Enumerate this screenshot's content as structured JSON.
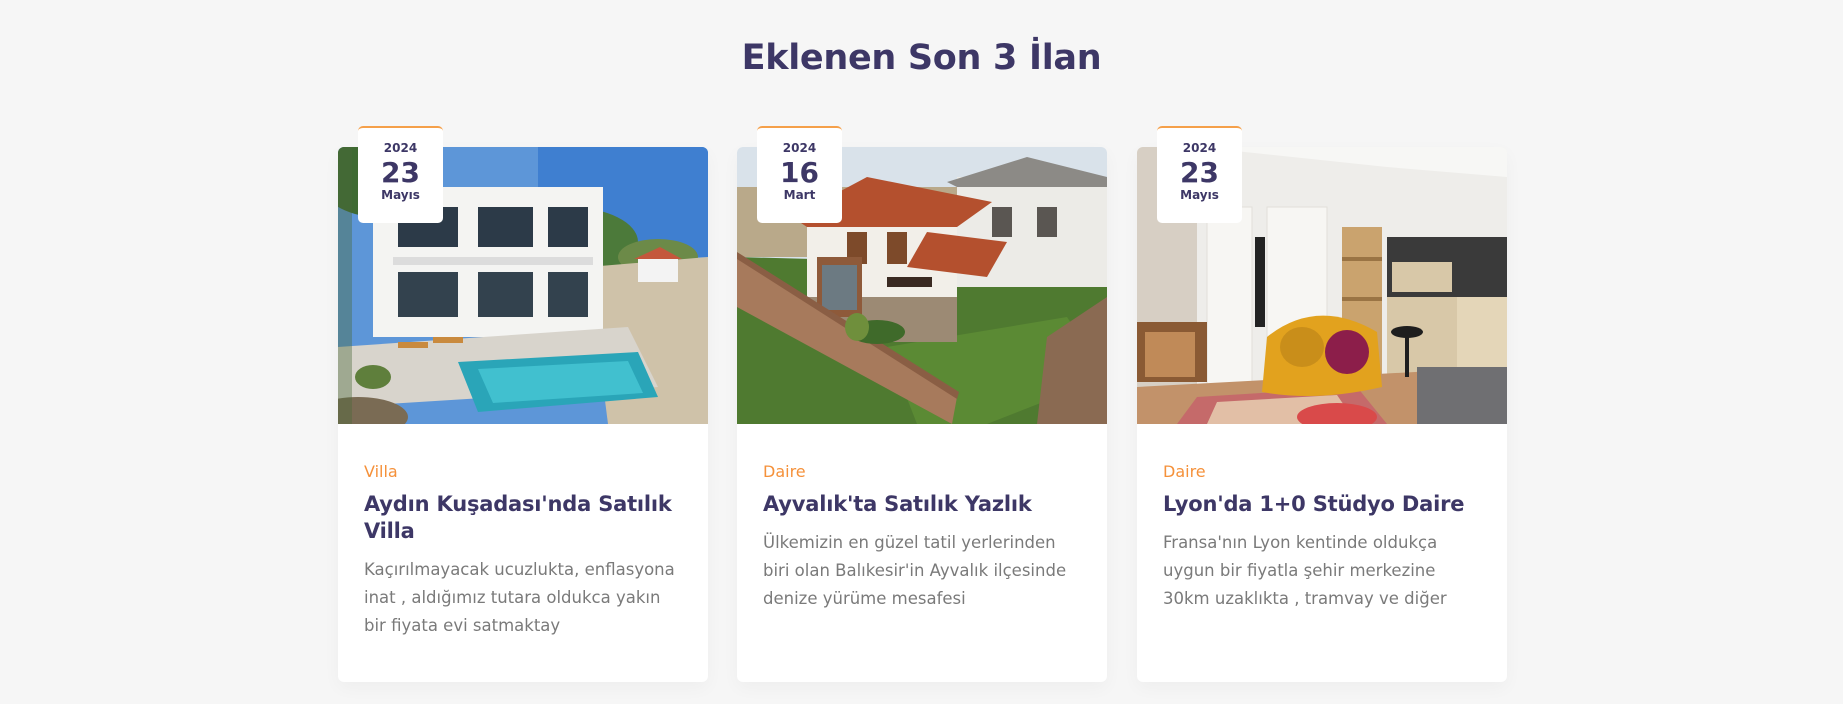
{
  "section": {
    "title": "Eklenen Son 3 İlan"
  },
  "listings": [
    {
      "year": "2024",
      "day": "23",
      "month": "Mayıs",
      "category": "Villa",
      "title": "Aydın Kuşadası'nda Satılık Villa",
      "description": "Kaçırılmayacak ucuzlukta, enflasyona inat , aldığımız tutara oldukca yakın bir fiyata evi satmaktay"
    },
    {
      "year": "2024",
      "day": "16",
      "month": "Mart",
      "category": "Daire",
      "title": "Ayvalık'ta Satılık Yazlık",
      "description": "Ülkemizin en güzel tatil yerlerinden biri olan Balıkesir'in Ayvalık ilçesinde denize yürüme mesafesi"
    },
    {
      "year": "2024",
      "day": "23",
      "month": "Mayıs",
      "category": "Daire",
      "title": "Lyon'da 1+0 Stüdyo Daire",
      "description": "Fransa'nın Lyon kentinde oldukça uygun bir fiyatla şehir merkezine 30km uzaklıkta , tramvay ve diğer"
    }
  ],
  "colors": {
    "background": "#f6f6f6",
    "heading": "#3d3766",
    "accent": "#f5913a",
    "body_text": "#7a7a7a"
  }
}
